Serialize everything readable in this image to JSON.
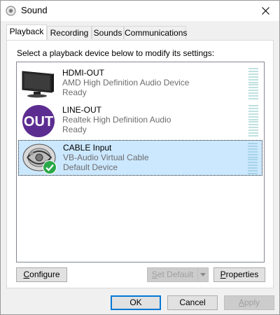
{
  "window": {
    "title": "Sound"
  },
  "tabs": [
    {
      "label": "Playback"
    },
    {
      "label": "Recording"
    },
    {
      "label": "Sounds"
    },
    {
      "label": "Communications"
    }
  ],
  "instruction": "Select a playback device below to modify its settings:",
  "devices": [
    {
      "name": "HDMI-OUT",
      "description": "AMD High Definition Audio Device",
      "status": "Ready",
      "icon": "monitor-icon"
    },
    {
      "name": "LINE-OUT",
      "description": "Realtek High Definition Audio",
      "status": "Ready",
      "icon": "line-out-icon",
      "icon_text": "OUT"
    },
    {
      "name": "CABLE Input",
      "description": "VB-Audio Virtual Cable",
      "status": "Default Device",
      "icon": "cable-icon",
      "selected": true
    }
  ],
  "buttons": {
    "configure_pre": "",
    "configure_u": "C",
    "configure_post": "onfigure",
    "set_default_u": "S",
    "set_default_post": "et Default",
    "properties_u": "P",
    "properties_post": "roperties",
    "ok": "OK",
    "cancel": "Cancel",
    "apply_u": "A",
    "apply_post": "pply"
  },
  "colors": {
    "selection": "#cce8ff",
    "accent": "#0078d7",
    "out_icon": "#5c2d91",
    "check": "#2aa84a"
  }
}
